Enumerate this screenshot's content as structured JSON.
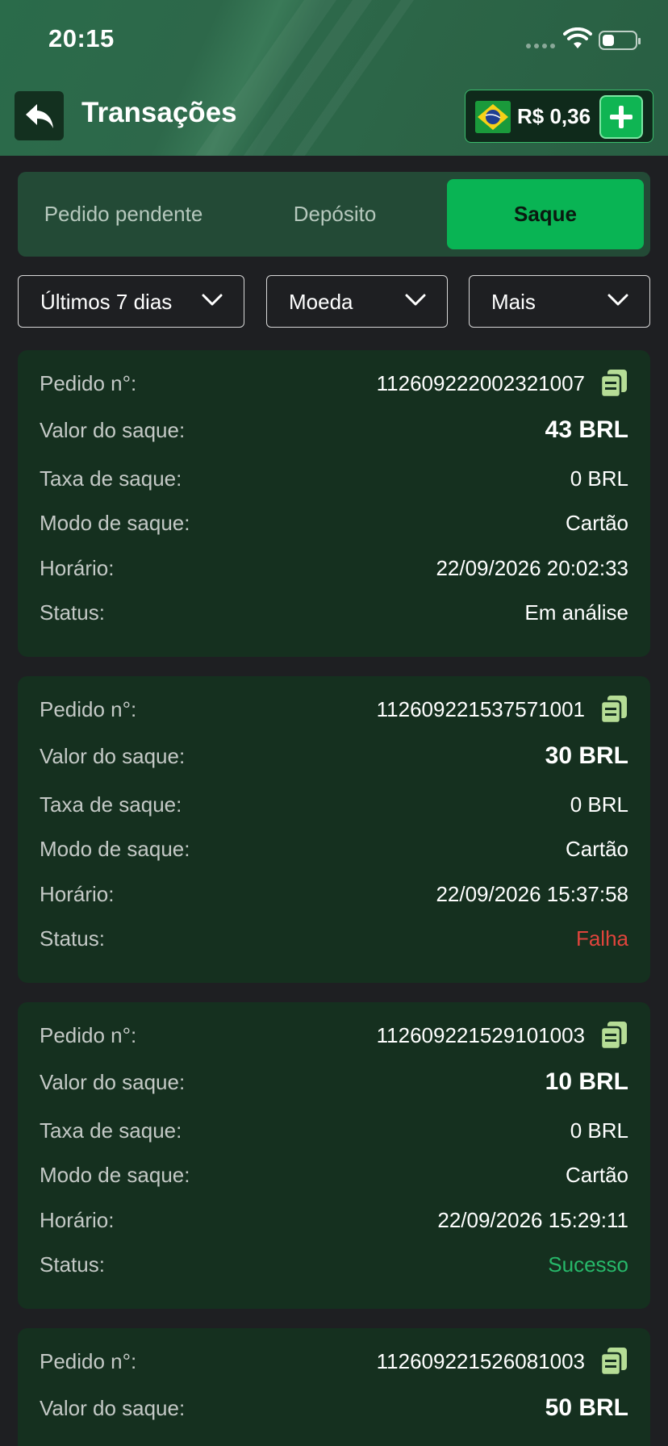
{
  "status_bar": {
    "time": "20:15"
  },
  "header": {
    "title": "Transações",
    "balance": "R$ 0,36"
  },
  "tabs": [
    {
      "label": "Pedido pendente",
      "active": false
    },
    {
      "label": "Depósito",
      "active": false
    },
    {
      "label": "Saque",
      "active": true
    }
  ],
  "filters": [
    {
      "label": "Últimos 7 dias"
    },
    {
      "label": "Moeda"
    },
    {
      "label": "Mais"
    }
  ],
  "labels": {
    "order": "Pedido n°:",
    "amount": "Valor do saque:",
    "fee": "Taxa de saque:",
    "mode": "Modo de saque:",
    "time": "Horário:",
    "status": "Status:"
  },
  "transactions": [
    {
      "order": "112609222002321007",
      "amount": "43 BRL",
      "fee": "0 BRL",
      "mode": "Cartão",
      "time": "22/09/2026 20:02:33",
      "status": "Em análise"
    },
    {
      "order": "112609221537571001",
      "amount": "30 BRL",
      "fee": "0 BRL",
      "mode": "Cartão",
      "time": "22/09/2026 15:37:58",
      "status": "Falha"
    },
    {
      "order": "112609221529101003",
      "amount": "10 BRL",
      "fee": "0 BRL",
      "mode": "Cartão",
      "time": "22/09/2026 15:29:11",
      "status": "Sucesso"
    },
    {
      "order": "112609221526081003",
      "amount": "50 BRL"
    }
  ],
  "colors": {
    "accent": "#09b454",
    "status_fail": "#e0443c",
    "status_success": "#27b86a"
  }
}
